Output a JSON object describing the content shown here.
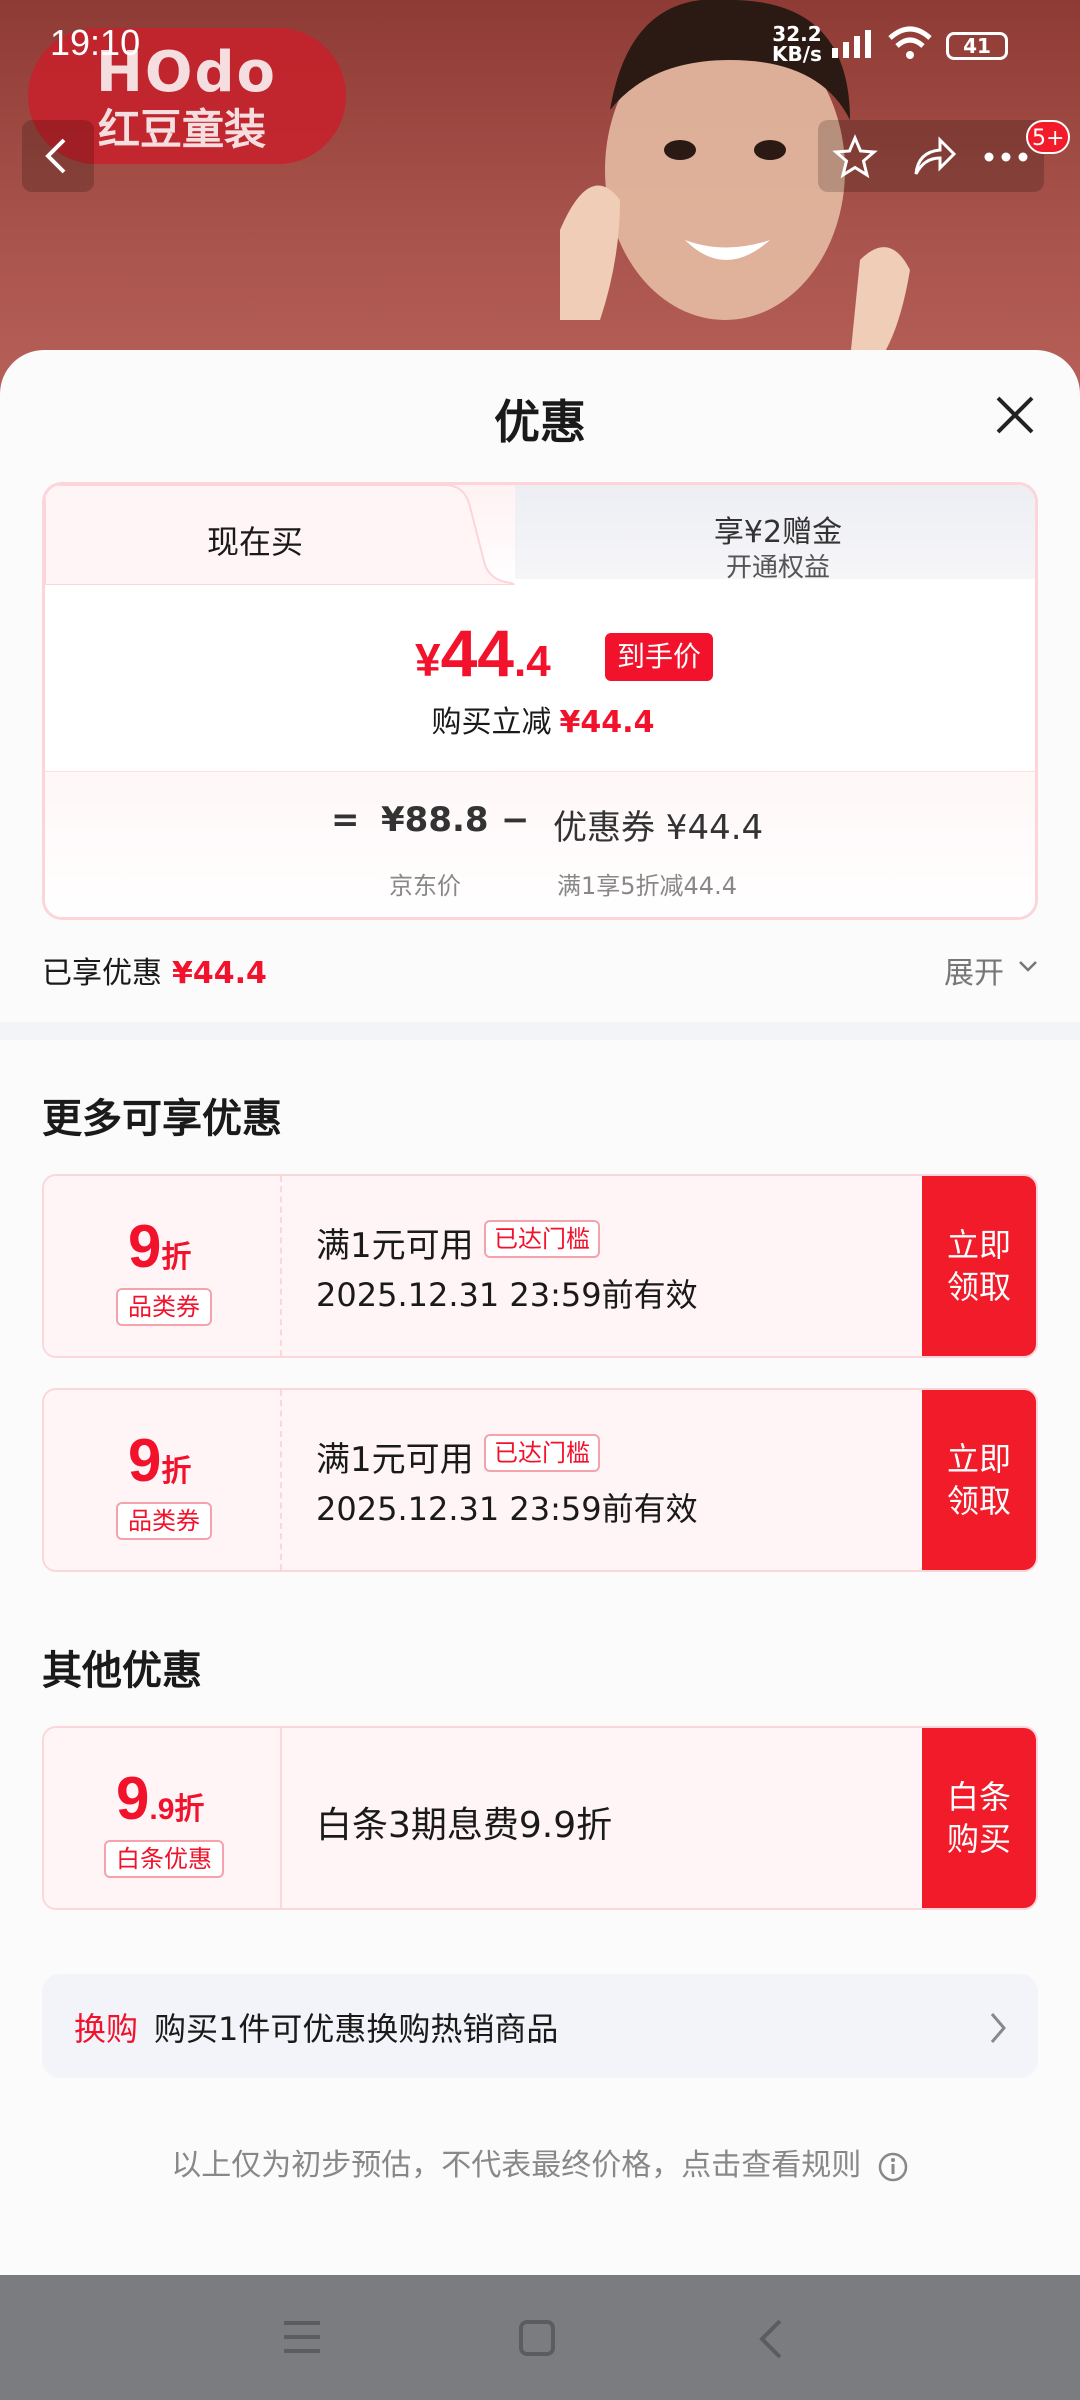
{
  "status_bar": {
    "time": "19:10",
    "net_speed": "32.2",
    "net_unit": "KB/s",
    "battery": "41"
  },
  "header": {
    "brand_logo": "HOdo",
    "brand_cn": "红豆童装",
    "notification_count": "5+"
  },
  "sheet": {
    "title": "优惠",
    "tabs": [
      {
        "label": "现在买"
      },
      {
        "label": "享¥2赠金",
        "sub": "开通权益"
      }
    ],
    "hand_price": {
      "currency": "¥",
      "int": "44",
      "dec": ".4",
      "tag": "到手价"
    },
    "reduce": {
      "label": "购买立减",
      "value": "¥44.4"
    },
    "calc": {
      "eq": "=",
      "price": "¥88.8",
      "price_label": "京东价",
      "minus": "−",
      "coupon": "优惠券 ¥44.4",
      "coupon_label": "满1享5折减44.4"
    },
    "enjoyed": {
      "label": "已享优惠",
      "value": "¥44.4"
    },
    "expand": "展开"
  },
  "more_offers": {
    "title": "更多可享优惠",
    "coupons": [
      {
        "num": "9",
        "unit": "折",
        "type": "品类券",
        "title": "满1元可用",
        "badge": "已达门槛",
        "date": "2025.12.31 23:59前有效",
        "button": "立即\n领取"
      },
      {
        "num": "9",
        "unit": "折",
        "type": "品类券",
        "title": "满1元可用",
        "badge": "已达门槛",
        "date": "2025.12.31 23:59前有效",
        "button": "立即\n领取"
      }
    ]
  },
  "other_offers": {
    "title": "其他优惠",
    "item": {
      "num": "9",
      "unit": ".9折",
      "type": "白条优惠",
      "title": "白条3期息费9.9折",
      "button": "白条\n购买"
    }
  },
  "exchange": {
    "tag": "换购",
    "text": "购买1件可优惠换购热销商品"
  },
  "footnote": "以上仅为初步预估，不代表最终价格，点击查看规则",
  "colors": {
    "accent": "#f2122c",
    "button": "#f21b2a",
    "border": "#fbd6db"
  }
}
